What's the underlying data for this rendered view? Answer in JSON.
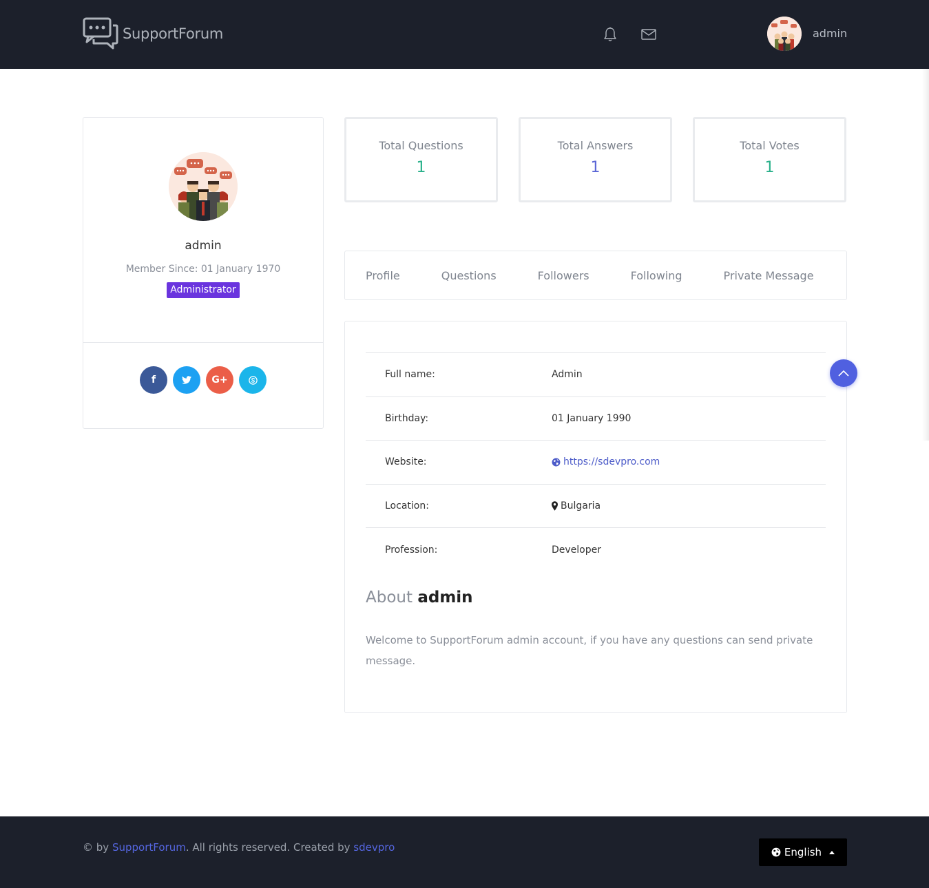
{
  "header": {
    "brand": "SupportForum",
    "username": "admin",
    "icons": [
      "bell-icon",
      "mail-icon"
    ]
  },
  "profile_card": {
    "name": "admin",
    "member_since": "Member Since: 01 January 1970",
    "role": "Administrator",
    "role_color": "#6a34de",
    "socials": [
      {
        "name": "facebook",
        "glyph": "f",
        "color": "#3b5998"
      },
      {
        "name": "twitter",
        "glyph": "t",
        "color": "#1da1f2"
      },
      {
        "name": "google-plus",
        "glyph": "G+",
        "color": "#eb5e48"
      },
      {
        "name": "skype",
        "glyph": "S",
        "color": "#1bb5ea"
      }
    ]
  },
  "stats": [
    {
      "label": "Total Questions",
      "value": "1",
      "color": "#28b08a"
    },
    {
      "label": "Total Answers",
      "value": "1",
      "color": "#5b66d6"
    },
    {
      "label": "Total Votes",
      "value": "1",
      "color": "#28b08a"
    }
  ],
  "tabs": [
    "Profile",
    "Questions",
    "Followers",
    "Following",
    "Private Message"
  ],
  "details": [
    {
      "label": "Full name:",
      "value": "Admin"
    },
    {
      "label": "Birthday:",
      "value": "01 January 1990"
    },
    {
      "label": "Website:",
      "value": "https://sdevpro.com",
      "icon": "globe-icon"
    },
    {
      "label": "Location:",
      "value": "Bulgaria",
      "icon": "map-marker-icon"
    },
    {
      "label": "Profession:",
      "value": "Developer"
    }
  ],
  "about": {
    "prefix": "About",
    "name": "admin",
    "text": "Welcome to SupportForum admin account, if you have any questions can send private message."
  },
  "footer": {
    "copyright_prefix": "© by",
    "brand_link": "SupportForum",
    "copyright_middle": ". All rights reserved. Created by",
    "author_link": "sdevpro",
    "language": "English"
  },
  "colors": {
    "header_bg": "#1c202b",
    "accent": "#5060e0"
  }
}
